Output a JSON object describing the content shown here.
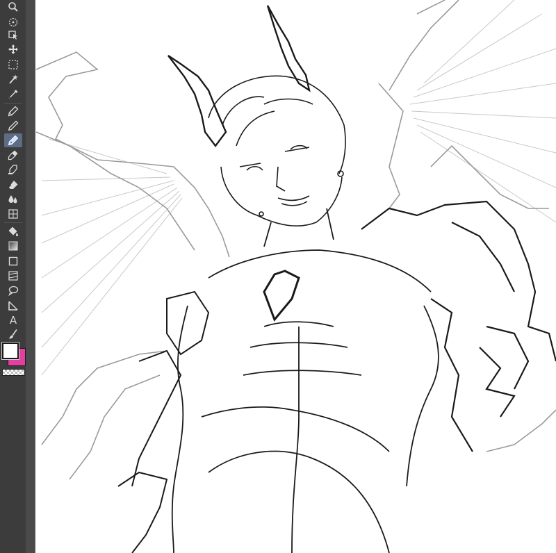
{
  "app": {
    "toolbar_icons": [
      "magnifier-icon",
      "rotate-view-icon",
      "object-select-icon",
      "move-icon",
      "selection-icon",
      "auto-select-wand-icon",
      "eyedropper-icon",
      "pen-icon",
      "pencil-icon",
      "marker-icon",
      "pen-active-icon",
      "ink-pen-icon",
      "eraser-icon",
      "blend-icon",
      "fill-bucket-icon",
      "gradient-icon",
      "rectangle-icon",
      "frame-icon",
      "lasso-icon",
      "ruler-icon",
      "text-icon",
      "brush-icon"
    ],
    "text_tool_glyph": "A",
    "colors": {
      "toolbar_bg": "#3c3c3c",
      "active_tool": "#5d6d86",
      "main_color": "#ffffff",
      "sub_color": "#e040a0",
      "canvas_bg": "#ffffff",
      "line_art": "#1a1a1a"
    }
  }
}
